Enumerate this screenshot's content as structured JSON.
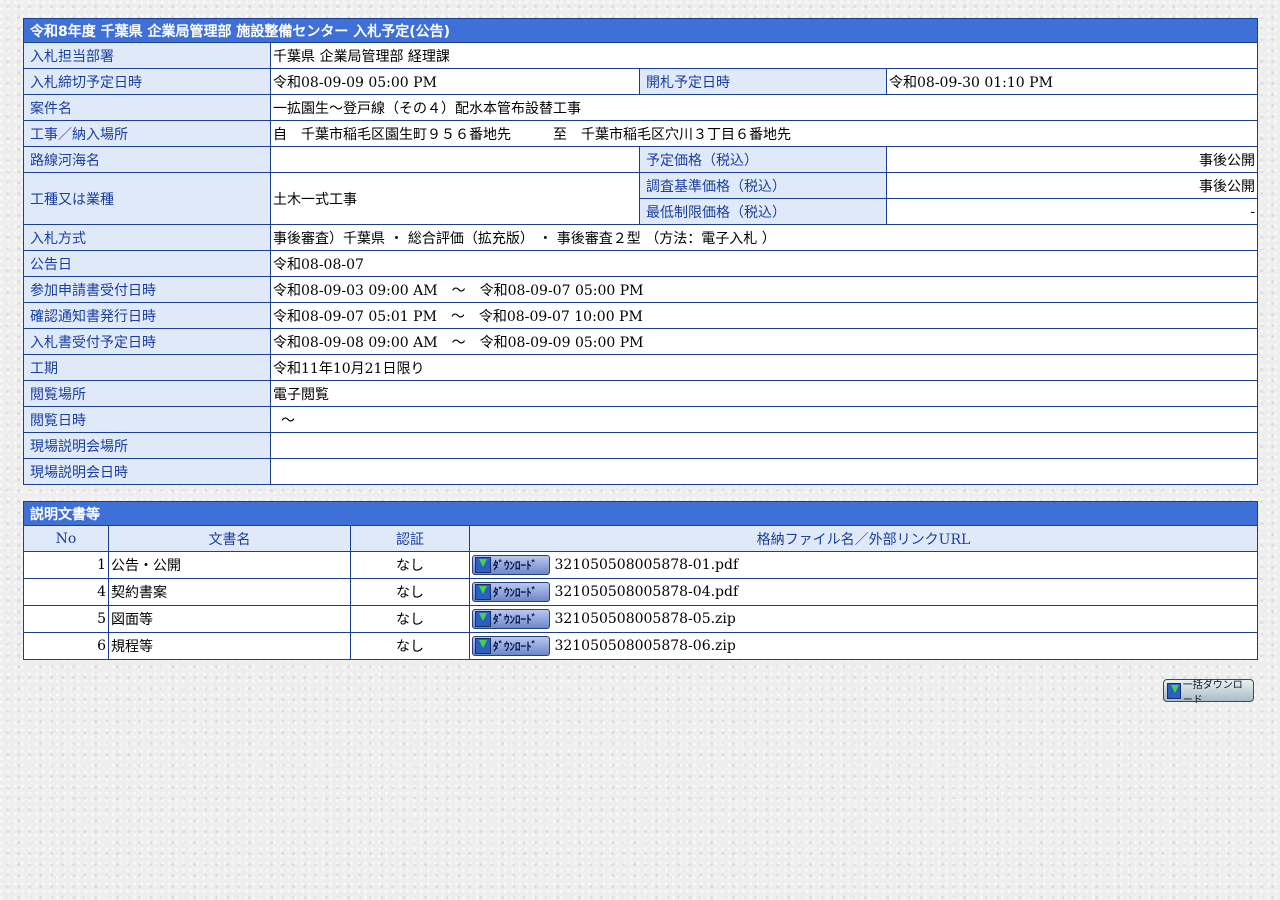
{
  "title": "令和8年度 千葉県 企業局管理部 施設整備センター 入札予定(公告)",
  "fields": {
    "dept_label": "入札担当部署",
    "dept_value": "千葉県 企業局管理部 経理課",
    "deadline_label": "入札締切予定日時",
    "deadline_value": "令和08-09-09 05:00 PM",
    "opening_label": "開札予定日時",
    "opening_value": "令和08-09-30 01:10 PM",
    "name_label": "案件名",
    "name_value": "一拡園生～登戸線（その４）配水本管布設替工事",
    "place_label": "工事／納入場所",
    "place_value": "自　千葉市稲毛区園生町９５６番地先　　　至　千葉市稲毛区穴川３丁目６番地先",
    "route_label": "路線河海名",
    "route_value": "",
    "est_price_label": "予定価格（税込）",
    "est_price_value": "事後公開",
    "type_label": "工種又は業種",
    "type_value": "土木一式工事",
    "survey_price_label": "調査基準価格（税込）",
    "survey_price_value": "事後公開",
    "min_price_label": "最低制限価格（税込）",
    "min_price_value": "-",
    "method_label": "入札方式",
    "method_value": "事後審査）千葉県 ・ 総合評価（拡充版） ・ 事後審査２型 （方法：電子入札 ）",
    "notice_label": "公告日",
    "notice_value": "令和08-08-07",
    "apply_label": "参加申請書受付日時",
    "apply_value": "令和08-09-03 09:00 AM　～　令和08-09-07 05:00 PM",
    "confirm_label": "確認通知書発行日時",
    "confirm_value": "令和08-09-07 05:01 PM　～　令和08-09-07 10:00 PM",
    "bidrecv_label": "入札書受付予定日時",
    "bidrecv_value": "令和08-09-08 09:00 AM　～　令和08-09-09 05:00 PM",
    "term_label": "工期",
    "term_value": "令和11年10月21日限り",
    "view_place_label": "閲覧場所",
    "view_place_value": "電子閲覧",
    "view_date_label": "閲覧日時",
    "view_date_value": "～",
    "site_place_label": "現場説明会場所",
    "site_place_value": "",
    "site_date_label": "現場説明会日時",
    "site_date_value": ""
  },
  "docs": {
    "title": "説明文書等",
    "headers": [
      "No",
      "文書名",
      "認証",
      "格納ファイル名／外部リンクURL"
    ],
    "download_label": "ﾀﾞｳﾝﾛｰﾄﾞ",
    "rows": [
      {
        "no": "1",
        "name": "公告・公開",
        "auth": "なし",
        "file": "321050508005878-01.pdf"
      },
      {
        "no": "4",
        "name": "契約書案",
        "auth": "なし",
        "file": "321050508005878-04.pdf"
      },
      {
        "no": "5",
        "name": "図面等",
        "auth": "なし",
        "file": "321050508005878-05.zip"
      },
      {
        "no": "6",
        "name": "規程等",
        "auth": "なし",
        "file": "321050508005878-06.zip"
      }
    ]
  },
  "bulk_download_label": "一括ダウンロード"
}
